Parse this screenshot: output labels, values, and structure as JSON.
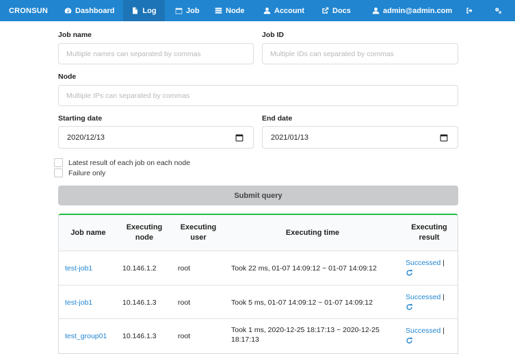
{
  "nav": {
    "brand": "CRONSUN",
    "items": [
      {
        "label": "Dashboard",
        "icon": "dashboard-icon"
      },
      {
        "label": "Log",
        "icon": "file-icon"
      },
      {
        "label": "Job",
        "icon": "calendar-icon"
      },
      {
        "label": "Node",
        "icon": "server-icon"
      },
      {
        "label": "Account",
        "icon": "user-icon"
      },
      {
        "label": "Docs",
        "icon": "external-link-icon"
      }
    ],
    "active": "Log",
    "user": "admin@admin.com",
    "user_icon": "user-icon",
    "logout_icon": "sign-out-icon",
    "settings_icon": "settings-icon",
    "color": "#2185d0"
  },
  "form": {
    "job_name": {
      "label": "Job name",
      "placeholder": "Multiple names can separated by commas",
      "value": ""
    },
    "job_id": {
      "label": "Job ID",
      "placeholder": "Multiple IDs can separated by commas",
      "value": ""
    },
    "node": {
      "label": "Node",
      "placeholder": "Multiple IPs can separated by commas",
      "value": ""
    },
    "start_date": {
      "label": "Starting date",
      "value": "2020/12/13"
    },
    "end_date": {
      "label": "End date",
      "value": "2021/01/13"
    },
    "latest_only": {
      "label": "Latest result of each job on each node",
      "checked": false
    },
    "failure_only": {
      "label": "Failure only",
      "checked": false
    },
    "submit_label": "Submit query"
  },
  "table": {
    "headers": {
      "job_name": "Job name",
      "node_line1": "Executing",
      "node_line2": "node",
      "user_line1": "Executing",
      "user_line2": "user",
      "time": "Executing time",
      "result_line1": "Executing",
      "result_line2": "result"
    },
    "rows": [
      {
        "job": "test-job1",
        "node": "10.146.1.2",
        "user": "root",
        "time_line1": "Took 22 ms, 01-07 14:09:12 ~ 01-07 14:09:12",
        "time_line2": "",
        "result": "Successed",
        "separator": "|"
      },
      {
        "job": "test-job1",
        "node": "10.146.1.3",
        "user": "root",
        "time_line1": "Took 5 ms, 01-07 14:09:12 ~ 01-07 14:09:12",
        "time_line2": "",
        "result": "Successed",
        "separator": "|"
      },
      {
        "job": "test_group01",
        "node": "10.146.1.3",
        "user": "root",
        "time_line1": "Took 1 ms, 2020-12-25 18:17:13 ~ 2020-12-25",
        "time_line2": "18:17:13",
        "result": "Successed",
        "separator": "|"
      }
    ],
    "accent": "#21ba45"
  }
}
